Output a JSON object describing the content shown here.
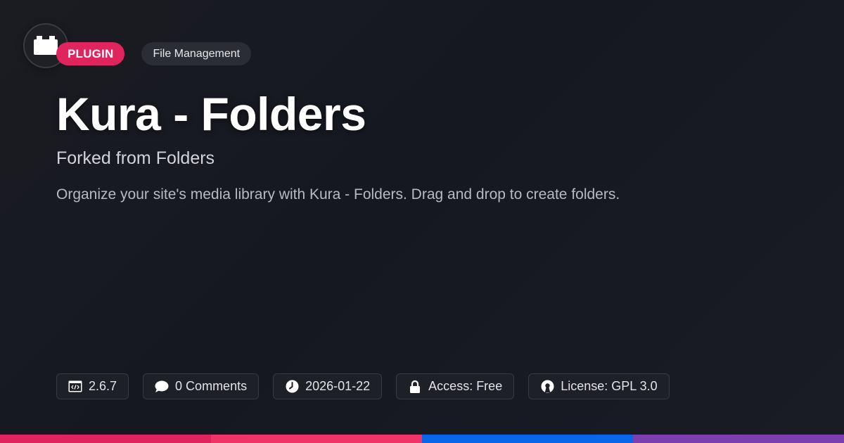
{
  "header": {
    "logo_icon": "folder-tab-icon",
    "badge_type": "PLUGIN",
    "badge_category": "File Management"
  },
  "main": {
    "title": "Kura - Folders",
    "subtitle": "Forked from Folders",
    "description": "Organize your site's media library with Kura - Folders. Drag and drop to create folders."
  },
  "meta": {
    "version": "2.6.7",
    "comments": "0 Comments",
    "date": "2026-01-22",
    "access": "Access: Free",
    "license": "License: GPL 3.0"
  },
  "colors": {
    "accent": "#e0245e",
    "stripe": [
      "#e0245e",
      "#f03468",
      "#0a66e8",
      "#7b3fb0"
    ]
  }
}
